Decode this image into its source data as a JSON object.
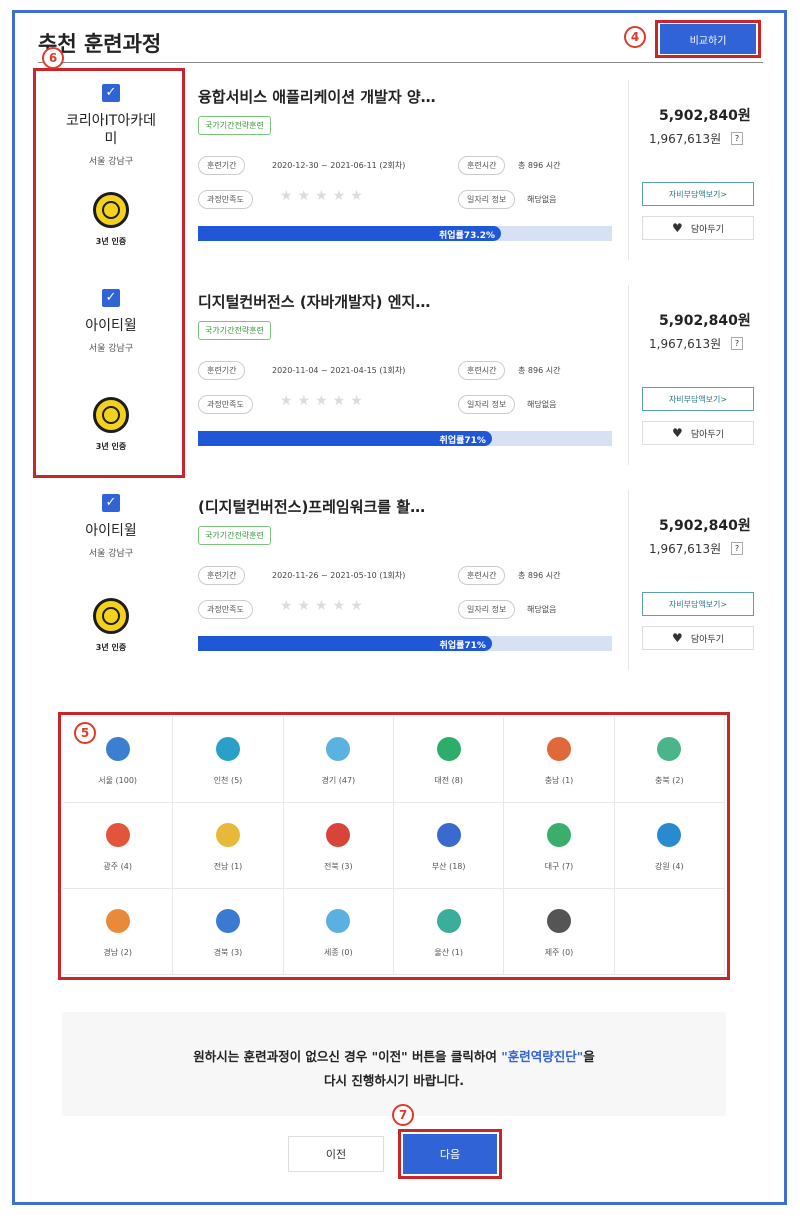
{
  "header": {
    "title": "추천 훈련과정",
    "compare_label": "비교하기"
  },
  "annotations": {
    "a4": "4",
    "a5": "5",
    "a6": "6",
    "a7": "7"
  },
  "courses": [
    {
      "institution": "코리아IT아카데미",
      "location": "서울 강남구",
      "cert": "3년 인증",
      "title": "융합서비스 애플리케이션 개발자 양…",
      "tag": "국가기간전략훈련",
      "period_label": "훈련기간",
      "period": "2020-12-30 ~ 2021-06-11 (2회차)",
      "hours_label": "훈련시간",
      "hours": "총 896 시간",
      "satisfaction_label": "과정만족도",
      "job_label": "일자리 정보",
      "job_value": "해당없음",
      "employment_text": "취업률73.2%",
      "employment_rate": 0.732,
      "price": "5,902,840원",
      "sub_price": "1,967,613원",
      "help": "?",
      "self_pay_label": "자비부담액보기>",
      "wish_label": "담아두기"
    },
    {
      "institution": "아이티윌",
      "location": "서울 강남구",
      "cert": "3년 인증",
      "title": "디지털컨버전스 (자바개발자) 엔지…",
      "tag": "국가기간전략훈련",
      "period_label": "훈련기간",
      "period": "2020-11-04 ~ 2021-04-15 (1회차)",
      "hours_label": "훈련시간",
      "hours": "총 896 시간",
      "satisfaction_label": "과정만족도",
      "job_label": "일자리 정보",
      "job_value": "해당없음",
      "employment_text": "취업률71%",
      "employment_rate": 0.71,
      "price": "5,902,840원",
      "sub_price": "1,967,613원",
      "help": "?",
      "self_pay_label": "자비부담액보기>",
      "wish_label": "담아두기"
    },
    {
      "institution": "아이티윌",
      "location": "서울 강남구",
      "cert": "3년 인증",
      "title": "(디지털컨버전스)프레임워크를 활…",
      "tag": "국가기간전략훈련",
      "period_label": "훈련기간",
      "period": "2020-11-26 ~ 2021-05-10 (1회차)",
      "hours_label": "훈련시간",
      "hours": "총 896 시간",
      "satisfaction_label": "과정만족도",
      "job_label": "일자리 정보",
      "job_value": "해당없음",
      "employment_text": "취업률71%",
      "employment_rate": 0.71,
      "price": "5,902,840원",
      "sub_price": "1,967,613원",
      "help": "?",
      "self_pay_label": "자비부담액보기>",
      "wish_label": "담아두기"
    }
  ],
  "regions": [
    {
      "label": "서울 (100)",
      "color": "#3a7fd0"
    },
    {
      "label": "인천 (5)",
      "color": "#2aa0c8"
    },
    {
      "label": "경기 (47)",
      "color": "#5ab2e0"
    },
    {
      "label": "대전 (8)",
      "color": "#2cae6a"
    },
    {
      "label": "충남 (1)",
      "color": "#e0683a"
    },
    {
      "label": "충북 (2)",
      "color": "#4ab48a"
    },
    {
      "label": "광주 (4)",
      "color": "#e2553a"
    },
    {
      "label": "전남 (1)",
      "color": "#e8b83a"
    },
    {
      "label": "전북 (3)",
      "color": "#d8443a"
    },
    {
      "label": "부산 (18)",
      "color": "#3a6ad0"
    },
    {
      "label": "대구 (7)",
      "color": "#3aae6a"
    },
    {
      "label": "강원 (4)",
      "color": "#2a8ad0"
    },
    {
      "label": "경남 (2)",
      "color": "#e88a3a"
    },
    {
      "label": "경북 (3)",
      "color": "#3a7ad0"
    },
    {
      "label": "세종 (0)",
      "color": "#5ab0e0"
    },
    {
      "label": "울산 (1)",
      "color": "#3aae9a"
    },
    {
      "label": "제주 (0)",
      "color": "#555555"
    },
    {
      "label": "",
      "color": "#ffffff"
    }
  ],
  "notice": {
    "line1_pre": "원하시는 훈련과정이 없으신 경우 \"이전\" 버튼을 클릭하여 ",
    "line1_hl": "\"훈련역량진단\"",
    "line1_post": "을",
    "line2": "다시 진행하시기 바랍니다."
  },
  "buttons": {
    "prev": "이전",
    "next": "다음"
  }
}
